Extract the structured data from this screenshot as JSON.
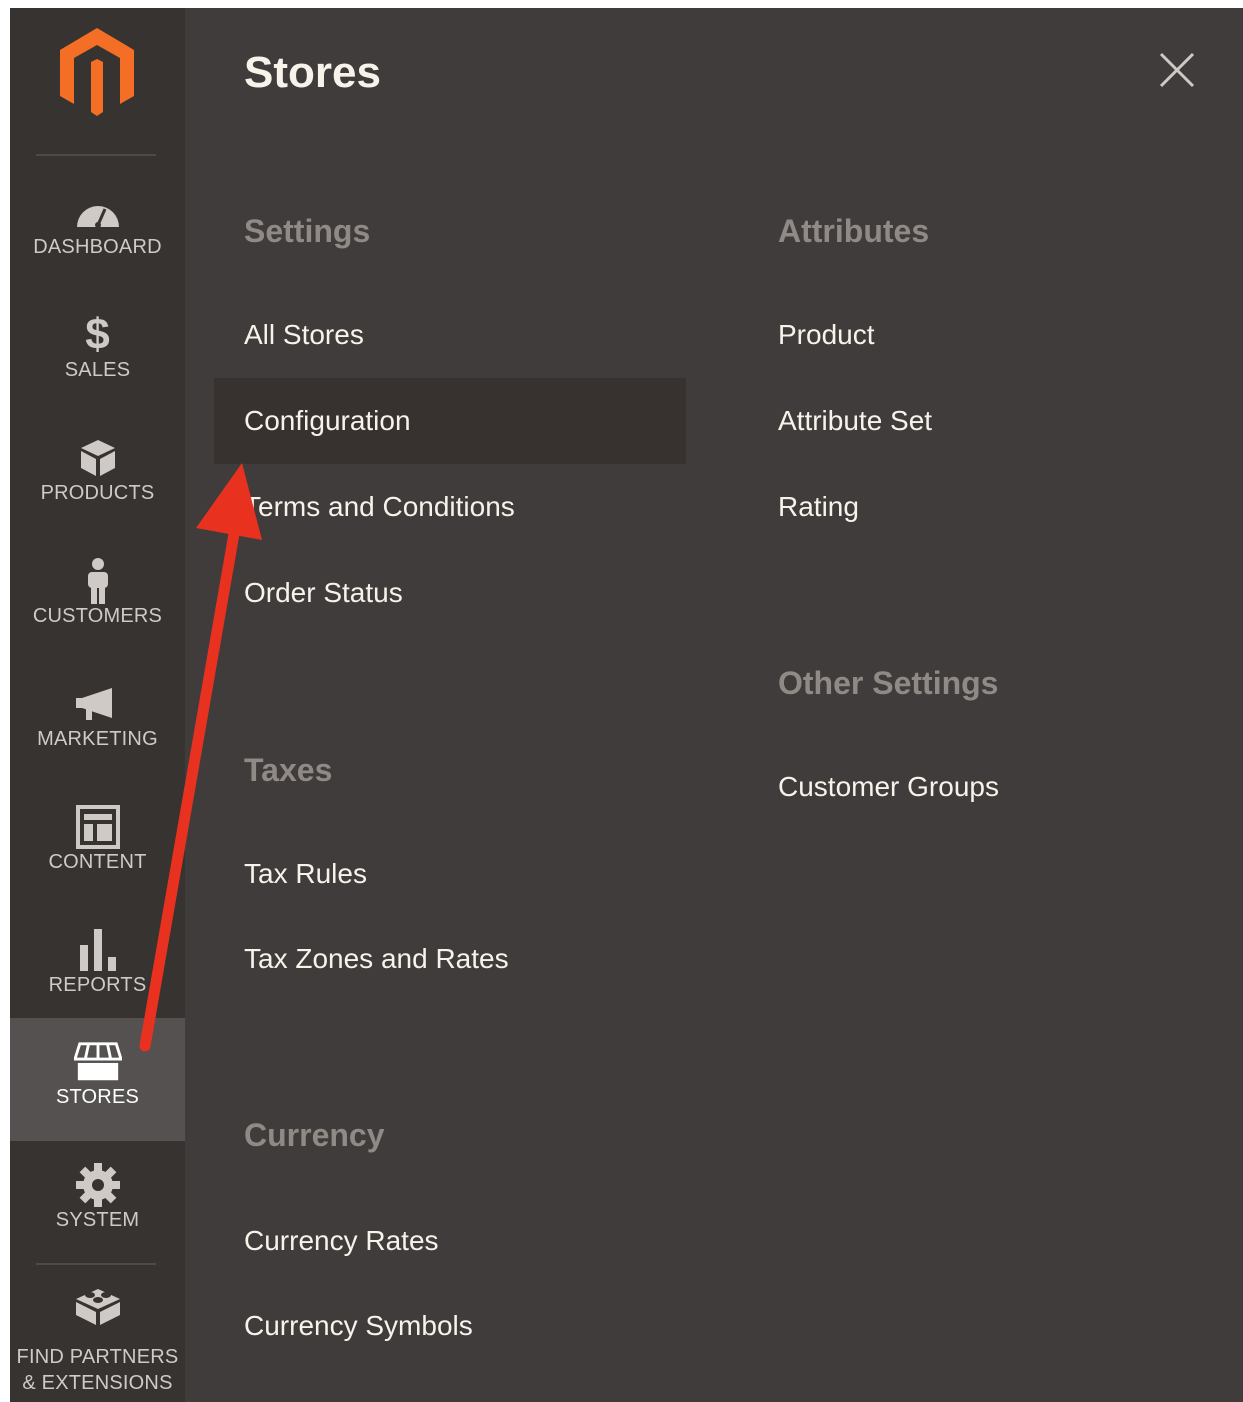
{
  "sidebar": {
    "items": [
      {
        "label": "DASHBOARD",
        "icon": "gauge-icon"
      },
      {
        "label": "SALES",
        "icon": "dollar-icon"
      },
      {
        "label": "PRODUCTS",
        "icon": "box-icon"
      },
      {
        "label": "CUSTOMERS",
        "icon": "person-icon"
      },
      {
        "label": "MARKETING",
        "icon": "megaphone-icon"
      },
      {
        "label": "CONTENT",
        "icon": "layout-icon"
      },
      {
        "label": "REPORTS",
        "icon": "bar-chart-icon"
      },
      {
        "label": "STORES",
        "icon": "storefront-icon",
        "active": true
      },
      {
        "label": "SYSTEM",
        "icon": "gear-icon"
      },
      {
        "label": "FIND PARTNERS\n& EXTENSIONS",
        "label_line1": "FIND PARTNERS",
        "label_line2": "& EXTENSIONS",
        "icon": "lego-block-icon"
      }
    ]
  },
  "panel": {
    "title": "Stores",
    "sections": {
      "settings": {
        "title": "Settings",
        "links": [
          "All Stores",
          "Configuration",
          "Terms and Conditions",
          "Order Status"
        ]
      },
      "taxes": {
        "title": "Taxes",
        "links": [
          "Tax Rules",
          "Tax Zones and Rates"
        ]
      },
      "currency": {
        "title": "Currency",
        "links": [
          "Currency Rates",
          "Currency Symbols"
        ]
      },
      "attributes": {
        "title": "Attributes",
        "links": [
          "Product",
          "Attribute Set",
          "Rating"
        ]
      },
      "other_settings": {
        "title": "Other Settings",
        "links": [
          "Customer Groups"
        ]
      }
    }
  },
  "colors": {
    "panel_bg": "#403c3b",
    "sidebar_bg": "#373330",
    "active_bg": "#555150",
    "brand_orange": "#eb5202",
    "annotation_arrow": "#e8321f"
  }
}
